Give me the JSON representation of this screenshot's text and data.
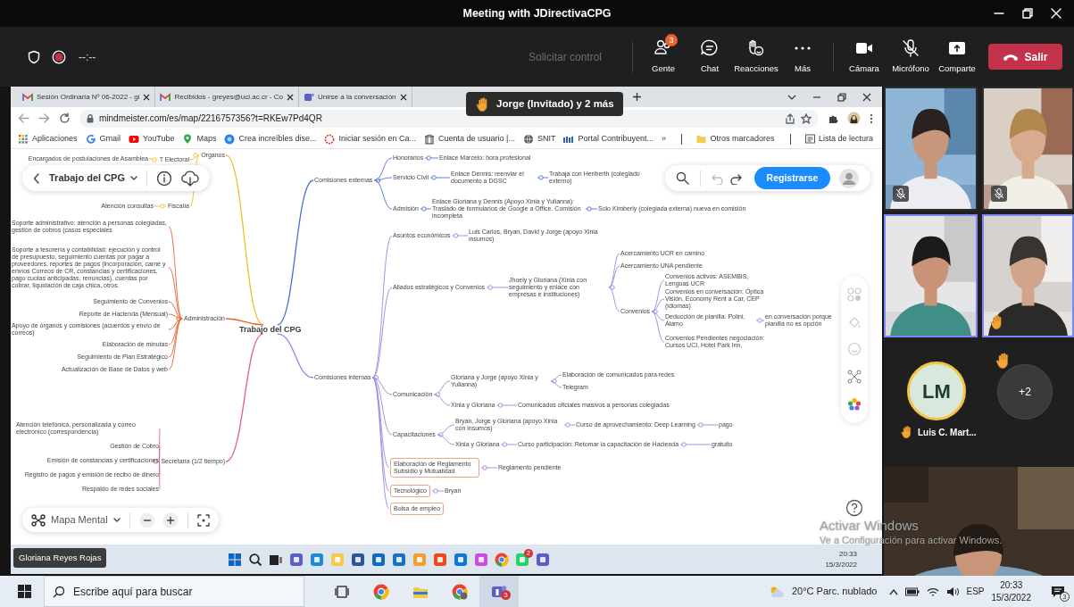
{
  "window": {
    "title": "Meeting with JDirectivaCPG"
  },
  "meeting_bar": {
    "timer": "--:--",
    "request_control": "Solicitar control",
    "microphone_muted": true,
    "actions": [
      {
        "kind": "people",
        "label": "Gente",
        "badge": "3"
      },
      {
        "kind": "chat",
        "label": "Chat"
      },
      {
        "kind": "reactions",
        "label": "Reacciones"
      },
      {
        "kind": "more",
        "label": "Más"
      },
      {
        "kind": "camera",
        "label": "Cámara"
      },
      {
        "kind": "microphone",
        "label": "Micrófono"
      },
      {
        "kind": "share",
        "label": "Comparte"
      }
    ],
    "leave": "Salir"
  },
  "notice": "Jorge (Invitado) y 2 más",
  "browser": {
    "tabs": [
      {
        "kind": "gmail",
        "title": "Sesión Ordinaria Nº 06-2022 - gi",
        "selected": false
      },
      {
        "kind": "gmail",
        "title": "Recibidos - greyes@uci.ac.cr - Co",
        "selected": false
      },
      {
        "kind": "teams",
        "title": "Unirse a la conversación",
        "selected": false
      }
    ],
    "url": "mindmeister.com/es/map/2216757356?t=RKEw7Pd4QR",
    "bookmarks": [
      {
        "kind": "apps",
        "label": "Aplicaciones"
      },
      {
        "kind": "google",
        "label": "Gmail"
      },
      {
        "kind": "youtube",
        "label": "YouTube"
      },
      {
        "kind": "maps",
        "label": "Maps"
      },
      {
        "kind": "canva",
        "label": "Crea increíbles dise..."
      },
      {
        "kind": "ring",
        "label": "Iniciar sesión en Ca..."
      },
      {
        "kind": "uh",
        "label": "Cuenta de usuario |..."
      },
      {
        "kind": "globe",
        "label": "SNIT"
      },
      {
        "kind": "mh",
        "label": "Portal Contribuyent..."
      }
    ],
    "overflow": "»",
    "other_bookmarks": "Otros marcadores",
    "reading_list": "Lista de lectura"
  },
  "mindmap": {
    "map_title": "Trabajo del CPG",
    "register": "Registrarse",
    "view": "Mapa Mental",
    "root": {
      "text": "Trabajo del CPG",
      "children": [
        {
          "text": "Organos",
          "children": [
            {
              "text": "T Electoral",
              "children": [
                {
                  "text": "Encargados de postulaciones de Asamblea"
                }
              ]
            },
            {
              "text": "Fiscalía",
              "children": [
                {
                  "text": "Atención consultas"
                }
              ]
            }
          ]
        },
        {
          "text": "Administración",
          "children": [
            {
              "text": "Soporte administrativo: atención a personas colegiadas, gestión de cobros (casos especiales"
            },
            {
              "text": "Soporte a tesorería y contabilidad: ejecución y control de presupuesto, seguimiento cuentas por pagar a proveedores, reportes de pagos (incorporación, carné y envíos Correos de CR, constancias y certificaciones, pago cuotas anticipadas, renuncias), cuentas por cobrar, liquidación de caja chica, otros."
            },
            {
              "text": "Seguimiento de Convenios"
            },
            {
              "text": "Reporte de Hacienda (Mensual)"
            },
            {
              "text": "Apoyo de órganos y comisiones (acuerdos y envío de correos)"
            },
            {
              "text": "Elaboración de minutas"
            },
            {
              "text": "Seguimiento de Plan Estratégico"
            },
            {
              "text": "Actualización de Base de Datos y web"
            }
          ]
        },
        {
          "text": "Secretaría (1/2 tiempo)",
          "children": [
            {
              "text": "Atención telefónica, personalizada y correo electrónico (correspondencia)"
            },
            {
              "text": "Gestión de Cobro"
            },
            {
              "text": "Emisión de constancias y certificaciones"
            },
            {
              "text": "Registro de pagos y emisión de recibo de dinero"
            },
            {
              "text": "Respaldo de redes sociales"
            }
          ]
        },
        {
          "text": "Comisiones externas",
          "children": [
            {
              "text": "Honorarios",
              "children": [
                {
                  "text": "Enlace Marcelo: hora profesional"
                }
              ]
            },
            {
              "text": "Servicio Civil",
              "children": [
                {
                  "text": "Enlace Dennis: reenviar el documento a DGSC",
                  "children": [
                    {
                      "text": "Trabaja con Heriberth (colegiado externo)"
                    }
                  ]
                }
              ]
            },
            {
              "text": "Admisión",
              "children": [
                {
                  "text": "Enlace Gloriana y Dennis (Apoyo Xinia y Yulianna): Traslado de formularios de Google a Office. Comisión incompleta",
                  "children": [
                    {
                      "text": "Solo Kimberly (colegiada externa) nueva en comisión"
                    }
                  ]
                }
              ]
            }
          ]
        },
        {
          "text": "Comisiones internas",
          "children": [
            {
              "text": "Asuntos económicos",
              "boxed": false,
              "children": [
                {
                  "text": "Luis Carlos, Bryan, David y Jorge (apoyo Xinia insumos)"
                }
              ]
            },
            {
              "text": "Aliados estratégicos y Convenios",
              "boxed": false,
              "children": [
                {
                  "text": "Jhoely y Gloriana (Xinia con seguimiento y enlace con empresas e instituciones)",
                  "children": [
                    {
                      "text": "Acercamiento UCR en camino"
                    },
                    {
                      "text": "Acercamiento UNA pendiente"
                    },
                    {
                      "text": "Convenios",
                      "children": [
                        {
                          "text": "Convenios activos: ASEMBIS, Lenguas UCR"
                        },
                        {
                          "text": "Convenios en conversación: Óptica Visión, Economy Rent a Car, CEP (idiomas)"
                        },
                        {
                          "text": "Deducción de planilla: Polini, Álamo",
                          "children": [
                            {
                              "text": "en conversación porque planilla no es opción"
                            }
                          ]
                        },
                        {
                          "text": "Convenios Pendientes negociación: Cursos UCI, Hotel Park Inn,"
                        }
                      ]
                    }
                  ]
                }
              ]
            },
            {
              "text": "Comunicación",
              "boxed": false,
              "children": [
                {
                  "text": "Gloriana y Jorge (apoyo Xinia y Yulianna)",
                  "children": [
                    {
                      "text": "Elaboración de comunicados para redes"
                    },
                    {
                      "text": "Telegram"
                    }
                  ]
                },
                {
                  "text": "Xinia y Gloriana",
                  "children": [
                    {
                      "text": "Comunicados oficiales masivos a personas colegiadas"
                    }
                  ]
                }
              ]
            },
            {
              "text": "Capacitaciones",
              "boxed": false,
              "children": [
                {
                  "text": "Bryan, Jorge y Gloriana (apoyo Xinia con insumos)",
                  "children": [
                    {
                      "text": "Curso de aprovechamiento: Deep Learning",
                      "children": [
                        {
                          "text": "pago"
                        }
                      ]
                    }
                  ]
                },
                {
                  "text": "Xinia y Gloriana",
                  "children": [
                    {
                      "text": "Curso participación: Retomar la capacitación de Hacienda",
                      "children": [
                        {
                          "text": "gratuito"
                        }
                      ]
                    }
                  ]
                }
              ]
            },
            {
              "text": "Elaboración de Reglamento Subsidio y Mutualidad",
              "boxed": true,
              "children": [
                {
                  "text": "Reglamento pendiente"
                }
              ]
            },
            {
              "text": "Tecnológico",
              "boxed": true,
              "children": [
                {
                  "text": "Bryan"
                }
              ]
            },
            {
              "text": "Bolsa de empleo",
              "boxed": true
            }
          ]
        }
      ]
    }
  },
  "presenter": "Gloriana Reyes Rojas",
  "shared_taskbar": {
    "apps": [
      {
        "kind": "start"
      },
      {
        "kind": "search"
      },
      {
        "kind": "taskview"
      },
      {
        "kind": "meet"
      },
      {
        "kind": "edge"
      },
      {
        "kind": "explorer"
      },
      {
        "kind": "store"
      },
      {
        "kind": "mail"
      },
      {
        "kind": "tile-blue"
      },
      {
        "kind": "tile-orange"
      },
      {
        "kind": "office"
      },
      {
        "kind": "outlook"
      },
      {
        "kind": "snip"
      },
      {
        "kind": "chrome"
      },
      {
        "kind": "whatsapp",
        "badge": "2"
      },
      {
        "kind": "teams"
      }
    ],
    "time": "20:33",
    "date": "15/3/2022"
  },
  "activation": {
    "title": "Activar Windows",
    "text": "Ve a Configuración para activar Windows."
  },
  "participants": {
    "tiles": [
      {
        "muted": true,
        "hand_raised": false,
        "highlighted": false
      },
      {
        "muted": true,
        "hand_raised": false,
        "highlighted": false
      },
      {
        "muted": false,
        "hand_raised": false,
        "highlighted": true
      },
      {
        "muted": false,
        "hand_raised": true,
        "highlighted": true
      }
    ],
    "avatar": {
      "initials": "LM",
      "name": "Luis C. Mart...",
      "hand_raised": true
    },
    "overflow": {
      "label": "+2",
      "hand_raised": true
    }
  },
  "taskbar": {
    "search": {
      "placeholder": "Escribe aquí para buscar"
    },
    "apps": [
      {
        "kind": "taskview",
        "active": false
      },
      {
        "kind": "chrome",
        "active": false
      },
      {
        "kind": "explorer",
        "active": false
      },
      {
        "kind": "chrome-profile",
        "active": false
      },
      {
        "kind": "teams",
        "active": true,
        "badge": "3"
      }
    ],
    "weather": "20°C Parc. nublado",
    "language": "ESP",
    "time": "20:33",
    "date": "15/3/2022",
    "notifications": "3"
  }
}
